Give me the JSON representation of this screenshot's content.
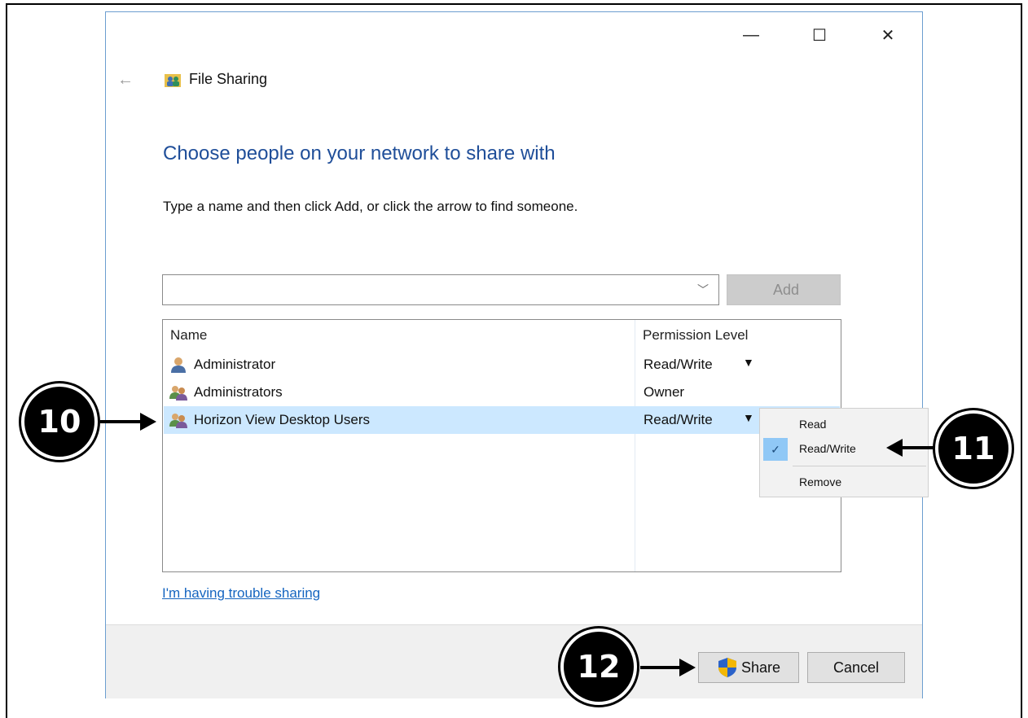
{
  "window": {
    "title": "File Sharing",
    "controls": {
      "minimize": "—",
      "maximize": "☐",
      "close": "✕"
    },
    "back_glyph": "←"
  },
  "heading": "Choose people on your network to share with",
  "instruction": "Type a name and then click Add, or click the arrow to find someone.",
  "name_input": {
    "value": "",
    "placeholder": ""
  },
  "add_button": "Add",
  "list": {
    "headers": {
      "name": "Name",
      "permission": "Permission Level"
    },
    "rows": [
      {
        "name": "Administrator",
        "permission": "Read/Write",
        "caret": "▼",
        "icon": "single-user-icon"
      },
      {
        "name": "Administrators",
        "permission": "Owner",
        "caret": "",
        "icon": "user-group-icon"
      },
      {
        "name": "Horizon View Desktop Users",
        "permission": "Read/Write",
        "caret": "▼",
        "icon": "user-group-icon"
      }
    ]
  },
  "permission_menu": {
    "items": [
      {
        "label": "Read",
        "checked": false
      },
      {
        "label": "Read/Write",
        "checked": true
      },
      {
        "label": "Remove",
        "checked": false
      }
    ],
    "check_glyph": "✓"
  },
  "trouble_link": "I'm having trouble sharing",
  "footer": {
    "share_button": "Share",
    "cancel_button": "Cancel"
  },
  "callouts": {
    "step_10": "10",
    "step_11": "11",
    "step_12": "12"
  },
  "colors": {
    "heading": "#1f4e99",
    "selected_row": "#cce8ff",
    "menu_check": "#90c8f6",
    "link": "#1565c0",
    "window_border": "#6c9ed0"
  }
}
